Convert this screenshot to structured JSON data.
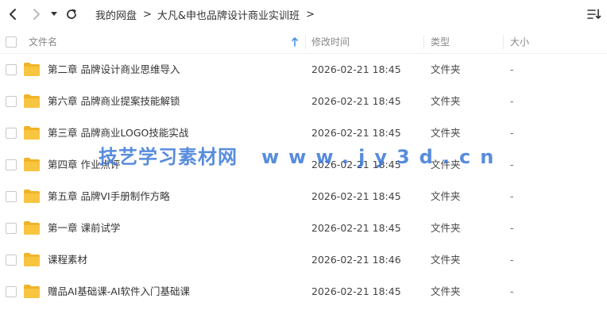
{
  "toolbar": {
    "breadcrumbs": [
      "我的网盘",
      "大凡&申也品牌设计商业实训班"
    ],
    "separator": ">"
  },
  "columns": {
    "name": "文件名",
    "mtime": "修改时间",
    "type": "类型",
    "size": "大小"
  },
  "rows": [
    {
      "name": "第二章 品牌设计商业思维导入",
      "mtime": "2026-02-21 18:45",
      "type": "文件夹",
      "size": "-"
    },
    {
      "name": "第六章 品牌商业提案技能解锁",
      "mtime": "2026-02-21 18:45",
      "type": "文件夹",
      "size": "-"
    },
    {
      "name": "第三章 品牌商业LOGO技能实战",
      "mtime": "2026-02-21 18:45",
      "type": "文件夹",
      "size": "-"
    },
    {
      "name": "第四章 作业点评",
      "mtime": "2026-02-21 18:45",
      "type": "文件夹",
      "size": "-"
    },
    {
      "name": "第五章 品牌VI手册制作方略",
      "mtime": "2026-02-21 18:45",
      "type": "文件夹",
      "size": "-"
    },
    {
      "name": "第一章 课前试学",
      "mtime": "2026-02-21 18:45",
      "type": "文件夹",
      "size": "-"
    },
    {
      "name": "课程素材",
      "mtime": "2026-02-21 18:46",
      "type": "文件夹",
      "size": "-"
    },
    {
      "name": "赠品AI基础课-AI软件入门基础课",
      "mtime": "2026-02-21 18:45",
      "type": "文件夹",
      "size": "-"
    }
  ],
  "watermark": {
    "text": "技艺学习素材网",
    "url": "www.jy3d.cn"
  },
  "colors": {
    "folder": "#f7c540",
    "folder_dark": "#f0b429",
    "accent": "#3b78d8",
    "sort_arrow": "#4a90e2"
  }
}
